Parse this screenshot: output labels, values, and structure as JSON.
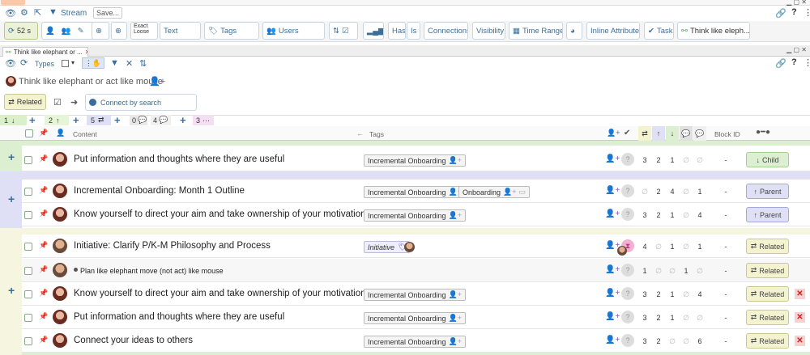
{
  "top_toolbar": {
    "stream": "Stream",
    "save": "Save...",
    "refresh": "52 s",
    "exact": "Exact",
    "loose": "Loose",
    "text_placeholder": "Text",
    "tags": "Tags",
    "users": "Users",
    "has": "Has",
    "is": "Is",
    "connections": "Connections",
    "visibility": "Visibility",
    "time_range": "Time Range",
    "inline_attributes": "Inline Attributes",
    "task": "Task",
    "think": "Think like eleph..."
  },
  "panel": {
    "tab": "Think like elephant or ...",
    "types": "Types",
    "title": "Think like elephant or act like mouse",
    "related": "Related",
    "connect_placeholder": "Connect by search"
  },
  "filterbar": {
    "green_a": "1",
    "green_b": "2",
    "blue": "5",
    "gray_a": "0",
    "gray_b": "4",
    "pink": "3"
  },
  "table": {
    "content": "Content",
    "tags": "Tags",
    "block_id": "Block ID"
  },
  "rows": [
    {
      "title": "Put information and thoughts where they are useful",
      "tags": [
        "Incremental Onboarding"
      ],
      "n1": "3",
      "n2": "2",
      "n3": "1",
      "n4": "∅",
      "n5": "∅",
      "dash": "-",
      "rel": "Child",
      "kind": "child"
    },
    {
      "title": "Incremental Onboarding: Month 1 Outline",
      "tags": [
        "Incremental Onboarding",
        "Onboarding"
      ],
      "n1": "∅",
      "n2": "2",
      "n3": "4",
      "n4": "∅",
      "n5": "1",
      "dash": "-",
      "rel": "Parent",
      "kind": "parent"
    },
    {
      "title": "Know yourself to direct your aim and take ownership of your motivation",
      "tags": [
        "Incremental Onboarding"
      ],
      "n1": "3",
      "n2": "2",
      "n3": "1",
      "n4": "∅",
      "n5": "4",
      "dash": "-",
      "rel": "Parent",
      "kind": "parent"
    },
    {
      "title": "Initiative: Clarify P/K-M Philosophy and Process",
      "tags": [
        "Initiative"
      ],
      "n1": "4",
      "n2": "∅",
      "n3": "1",
      "n4": "∅",
      "n5": "1",
      "dash": "-",
      "rel": "Related",
      "kind": "related"
    },
    {
      "title": "Plan like elephant move (not act) like mouse",
      "tags": [],
      "n1": "1",
      "n2": "∅",
      "n3": "∅",
      "n4": "1",
      "n5": "∅",
      "dash": "-",
      "rel": "Related",
      "kind": "related"
    },
    {
      "title": "Know yourself to direct your aim and take ownership of your motivation",
      "tags": [
        "Incremental Onboarding"
      ],
      "n1": "3",
      "n2": "2",
      "n3": "1",
      "n4": "∅",
      "n5": "4",
      "dash": "-",
      "rel": "Related",
      "kind": "related"
    },
    {
      "title": "Put information and thoughts where they are useful",
      "tags": [
        "Incremental Onboarding"
      ],
      "n1": "3",
      "n2": "2",
      "n3": "1",
      "n4": "∅",
      "n5": "∅",
      "dash": "-",
      "rel": "Related",
      "kind": "related"
    },
    {
      "title": "Connect your ideas to others",
      "tags": [
        "Incremental Onboarding"
      ],
      "n1": "3",
      "n2": "2",
      "n3": "∅",
      "n4": "∅",
      "n5": "6",
      "dash": "-",
      "rel": "Related",
      "kind": "related"
    }
  ]
}
